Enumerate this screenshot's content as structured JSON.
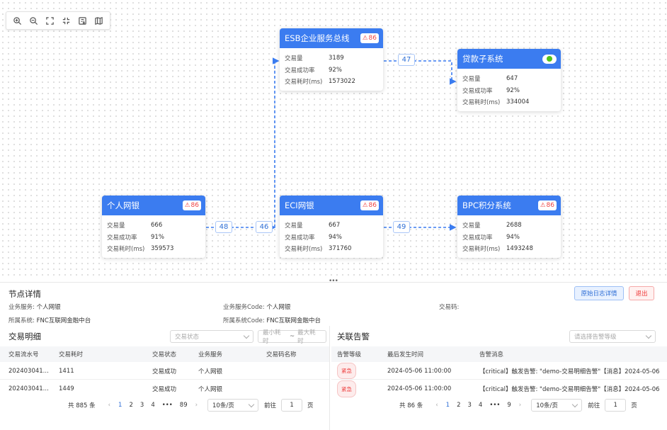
{
  "toolbar": {
    "icons": [
      "zoom-in-icon",
      "zoom-out-icon",
      "fit-view-icon",
      "actual-size-icon",
      "download-icon",
      "minimap-icon"
    ]
  },
  "nodes": [
    {
      "id": "esb",
      "title": "ESB企业服务总线",
      "badge": "86",
      "status": "badge",
      "rows": [
        [
          "交易量",
          "3189"
        ],
        [
          "交易成功率",
          "92%"
        ],
        [
          "交易耗时(ms)",
          "1573022"
        ]
      ]
    },
    {
      "id": "loan",
      "title": "贷款子系统",
      "badge": "",
      "status": "online",
      "rows": [
        [
          "交易量",
          "647"
        ],
        [
          "交易成功率",
          "92%"
        ],
        [
          "交易耗时(ms)",
          "334004"
        ]
      ]
    },
    {
      "id": "personal",
      "title": "个人网银",
      "badge": "86",
      "status": "badge",
      "rows": [
        [
          "交易量",
          "666"
        ],
        [
          "交易成功率",
          "91%"
        ],
        [
          "交易耗时(ms)",
          "359573"
        ]
      ]
    },
    {
      "id": "eci",
      "title": "ECI网银",
      "badge": "86",
      "status": "badge",
      "rows": [
        [
          "交易量",
          "667"
        ],
        [
          "交易成功率",
          "94%"
        ],
        [
          "交易耗时(ms)",
          "371760"
        ]
      ]
    },
    {
      "id": "bpc",
      "title": "BPC积分系统",
      "badge": "86",
      "status": "badge",
      "rows": [
        [
          "交易量",
          "2688"
        ],
        [
          "交易成功率",
          "94%"
        ],
        [
          "交易耗时(ms)",
          "1493248"
        ]
      ]
    }
  ],
  "edges": {
    "personal_eci": "48",
    "eci_in": "46",
    "esb_loan": "47",
    "eci_bpc": "49"
  },
  "badge_icon": "alert-icon",
  "detail": {
    "title": "节点详情",
    "service_label": "业务服务:",
    "service_value": "个人网银",
    "service_code_label": "业务服务Code:",
    "service_code_value": "个人网银",
    "trade_code_label": "交易码:",
    "trade_code_value": "",
    "system_label": "所属系统:",
    "system_value": "FNC互联网金融中台",
    "system_code_label": "所属系统Code:",
    "system_code_value": "FNC互联网金融中台",
    "raw_log_button": "原始日志详情",
    "exit_button": "退出"
  },
  "transactions": {
    "title": "交易明细",
    "status_placeholder": "交易状态",
    "min_placeholder": "最小耗时",
    "range_sep": "~",
    "max_placeholder": "最大耗时",
    "columns": [
      "交易流水号",
      "交易耗时",
      "交易状态",
      "业务服务",
      "交易码名称"
    ],
    "rows": [
      [
        "202403041...",
        "1411",
        "交易成功",
        "个人网银",
        ""
      ],
      [
        "202403041...",
        "1449",
        "交易成功",
        "个人网银",
        ""
      ]
    ],
    "pager": {
      "total": "共 885 条",
      "pages": [
        "1",
        "2",
        "3",
        "4",
        "•••",
        "89"
      ],
      "active": "1",
      "size": "10条/页",
      "goto": "前往",
      "goto_value": "1",
      "page_suffix": "页"
    }
  },
  "alerts": {
    "title": "关联告警",
    "level_placeholder": "请选择告警等级",
    "columns": [
      "告警等级",
      "最后发生时间",
      "告警消息"
    ],
    "rows": [
      [
        "紧急",
        "2024-05-06 11:00:00",
        "【critical】触发告警: \"demo-交易明细告警\"【消息】2024-05-06"
      ],
      [
        "紧急",
        "2024-05-06 11:00:00",
        "【critical】触发告警: \"demo-交易明细告警\"【消息】2024-05-06"
      ]
    ],
    "pager": {
      "total": "共 86 条",
      "pages": [
        "1",
        "2",
        "3",
        "4",
        "•••",
        "9"
      ],
      "active": "1",
      "size": "10条/页",
      "goto": "前往",
      "goto_value": "1",
      "page_suffix": "页"
    }
  },
  "colors": {
    "node_header": "#3b7cf0",
    "edge": "#3b7cf0",
    "danger": "#ee4444",
    "online": "#52c41a"
  }
}
